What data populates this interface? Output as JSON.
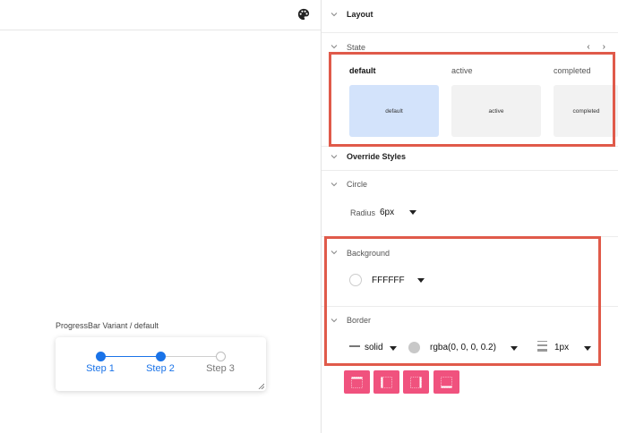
{
  "canvas": {
    "variant_caption": "ProgressBar Variant / default",
    "steps": [
      {
        "label": "Step 1",
        "status": "done"
      },
      {
        "label": "Step 2",
        "status": "done"
      },
      {
        "label": "Step 3",
        "status": "todo"
      }
    ]
  },
  "panel": {
    "layout_title": "Layout",
    "state_title": "State",
    "nav": {
      "prev": "‹",
      "next": "›"
    },
    "state_tabs": [
      {
        "label": "default",
        "card": "default",
        "selected": true
      },
      {
        "label": "active",
        "card": "active",
        "selected": false
      },
      {
        "label": "completed",
        "card": "completed",
        "selected": false
      }
    ],
    "override_title": "Override Styles",
    "circle_title": "Circle",
    "radius_label": "Radius",
    "radius_value": "6px",
    "background_title": "Background",
    "background_value": "FFFFFF",
    "border_title": "Border",
    "border_style": "solid",
    "border_color": "rgba(0, 0, 0, 0.2)",
    "border_width": "1px"
  },
  "colors": {
    "accent": "#1a73e8",
    "highlight": "#e05a4a",
    "tool_button": "#f0527e",
    "selected_card": "#d3e3fb"
  },
  "icons": [
    "palette-icon",
    "chevron-down-icon",
    "chevron-left-icon",
    "chevron-right-icon",
    "border-top-icon",
    "border-left-icon",
    "border-right-icon",
    "border-bottom-icon",
    "resize-grip-icon"
  ]
}
